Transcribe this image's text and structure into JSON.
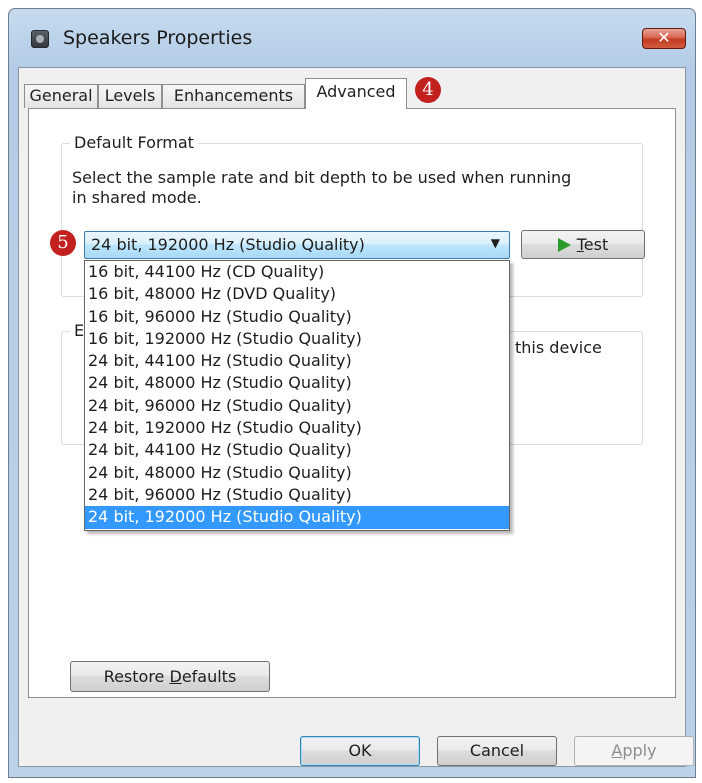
{
  "window": {
    "title": "Speakers Properties",
    "close_label": "✕"
  },
  "tabs": [
    {
      "label": "General",
      "active": false
    },
    {
      "label": "Levels",
      "active": false
    },
    {
      "label": "Enhancements",
      "active": false
    },
    {
      "label": "Advanced",
      "active": true
    }
  ],
  "markers": {
    "tab_marker": "4",
    "combo_marker": "5"
  },
  "default_format": {
    "group_title": "Default Format",
    "description_line1": "Select the sample rate and bit depth to be used when running",
    "description_line2": "in shared mode.",
    "selected_value": "24 bit, 192000 Hz (Studio Quality)",
    "test_button": {
      "label": "Test",
      "mnemonic": "T",
      "rest": "est"
    },
    "options": [
      "16 bit, 44100 Hz (CD Quality)",
      "16 bit, 48000 Hz (DVD Quality)",
      "16 bit, 96000 Hz (Studio Quality)",
      "16 bit, 192000 Hz (Studio Quality)",
      "24 bit, 44100 Hz (Studio Quality)",
      "24 bit, 48000 Hz (Studio Quality)",
      "24 bit, 96000 Hz (Studio Quality)",
      "24 bit, 192000 Hz (Studio Quality)",
      "24 bit, 44100 Hz (Studio Quality)",
      "24 bit, 48000 Hz (Studio Quality)",
      "24 bit, 96000 Hz (Studio Quality)",
      "24 bit, 192000 Hz (Studio Quality)"
    ],
    "selected_index": 11
  },
  "exclusive_mode": {
    "group_title_partial": "E",
    "text_partial": "this device"
  },
  "restore_defaults": {
    "pre": "Restore ",
    "mnemonic": "D",
    "post": "efaults"
  },
  "footer": {
    "ok_label": "OK",
    "cancel_label": "Cancel",
    "apply_pre": "",
    "apply_mnemonic": "A",
    "apply_post": "pply"
  },
  "colors": {
    "marker": "#c2211f",
    "selection": "#3399ff",
    "close": "#c33a22"
  },
  "icons": {
    "title": "speaker-icon",
    "test": "play-icon",
    "combo": "chevron-down-icon"
  }
}
